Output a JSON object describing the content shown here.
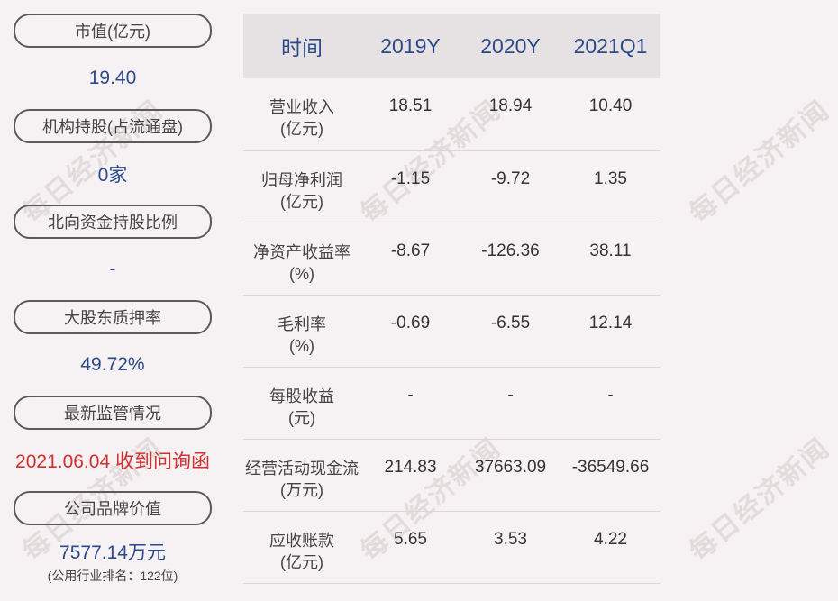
{
  "watermark": "每日经济新闻",
  "metrics": [
    {
      "label": "市值(亿元)",
      "value": "19.40"
    },
    {
      "label": "机构持股(占流通盘)",
      "value": "0家"
    },
    {
      "label": "北向资金持股比例",
      "value": "-"
    },
    {
      "label": "大股东质押率",
      "value": "49.72%"
    },
    {
      "label": "最新监管情况",
      "value": "2021.06.04 收到问询函"
    },
    {
      "label": "公司品牌价值",
      "value": "7577.14万元",
      "sub": "(公用行业排名：122位)"
    }
  ],
  "table": {
    "headers": [
      "时间",
      "2019Y",
      "2020Y",
      "2021Q1"
    ],
    "rows": [
      {
        "name": "营业收入",
        "unit": "(亿元)",
        "values": [
          "18.51",
          "18.94",
          "10.40"
        ]
      },
      {
        "name": "归母净利润",
        "unit": "(亿元)",
        "values": [
          "-1.15",
          "-9.72",
          "1.35"
        ]
      },
      {
        "name": "净资产收益率",
        "unit": "(%)",
        "values": [
          "-8.67",
          "-126.36",
          "38.11"
        ]
      },
      {
        "name": "毛利率",
        "unit": "(%)",
        "values": [
          "-0.69",
          "-6.55",
          "12.14"
        ]
      },
      {
        "name": "每股收益",
        "unit": "(元)",
        "values": [
          "-",
          "-",
          "-"
        ]
      },
      {
        "name": "经营活动现金流",
        "unit": "(万元)",
        "values": [
          "214.83",
          "37663.09",
          "-36549.66"
        ]
      },
      {
        "name": "应收账款",
        "unit": "(亿元)",
        "values": [
          "5.65",
          "3.53",
          "4.22"
        ]
      }
    ]
  },
  "colors": {
    "accent": "#2c4a8a",
    "alert": "#d32f2f",
    "background": "#f6f1f2"
  }
}
